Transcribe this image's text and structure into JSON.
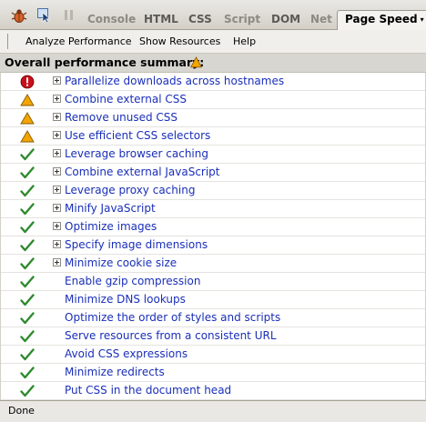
{
  "toolbar": {
    "tabs": [
      {
        "label": "Console",
        "style": "muted"
      },
      {
        "label": "HTML",
        "style": "dark"
      },
      {
        "label": "CSS",
        "style": "dark"
      },
      {
        "label": "Script",
        "style": "muted"
      },
      {
        "label": "DOM",
        "style": "dark"
      },
      {
        "label": "Net",
        "style": "muted"
      },
      {
        "label": "Page Speed",
        "style": "active"
      }
    ],
    "active_tab_arrow": "▾"
  },
  "menu": {
    "items": [
      "Analyze Performance",
      "Show Resources",
      "Help"
    ]
  },
  "summary": {
    "title": "Overall performance summary:",
    "status_icon": "warning-icon"
  },
  "rules": [
    {
      "label": "Parallelize downloads across hostnames",
      "status": "error",
      "expandable": true
    },
    {
      "label": "Combine external CSS",
      "status": "warning",
      "expandable": true
    },
    {
      "label": "Remove unused CSS",
      "status": "warning",
      "expandable": true
    },
    {
      "label": "Use efficient CSS selectors",
      "status": "warning",
      "expandable": true
    },
    {
      "label": "Leverage browser caching",
      "status": "pass",
      "expandable": true
    },
    {
      "label": "Combine external JavaScript",
      "status": "pass",
      "expandable": true
    },
    {
      "label": "Leverage proxy caching",
      "status": "pass",
      "expandable": true
    },
    {
      "label": "Minify JavaScript",
      "status": "pass",
      "expandable": true
    },
    {
      "label": "Optimize images",
      "status": "pass",
      "expandable": true
    },
    {
      "label": "Specify image dimensions",
      "status": "pass",
      "expandable": true
    },
    {
      "label": "Minimize cookie size",
      "status": "pass",
      "expandable": true
    },
    {
      "label": "Enable gzip compression",
      "status": "pass",
      "expandable": false
    },
    {
      "label": "Minimize DNS lookups",
      "status": "pass",
      "expandable": false
    },
    {
      "label": "Optimize the order of styles and scripts",
      "status": "pass",
      "expandable": false
    },
    {
      "label": "Serve resources from a consistent URL",
      "status": "pass",
      "expandable": false
    },
    {
      "label": "Avoid CSS expressions",
      "status": "pass",
      "expandable": false
    },
    {
      "label": "Minimize redirects",
      "status": "pass",
      "expandable": false
    },
    {
      "label": "Put CSS in the document head",
      "status": "pass",
      "expandable": false
    }
  ],
  "status_bar": {
    "text": "Done"
  },
  "colors": {
    "link": "#1a2fb8",
    "pass": "#2e8a2e",
    "warning": "#f2a400",
    "error": "#c8101a"
  }
}
